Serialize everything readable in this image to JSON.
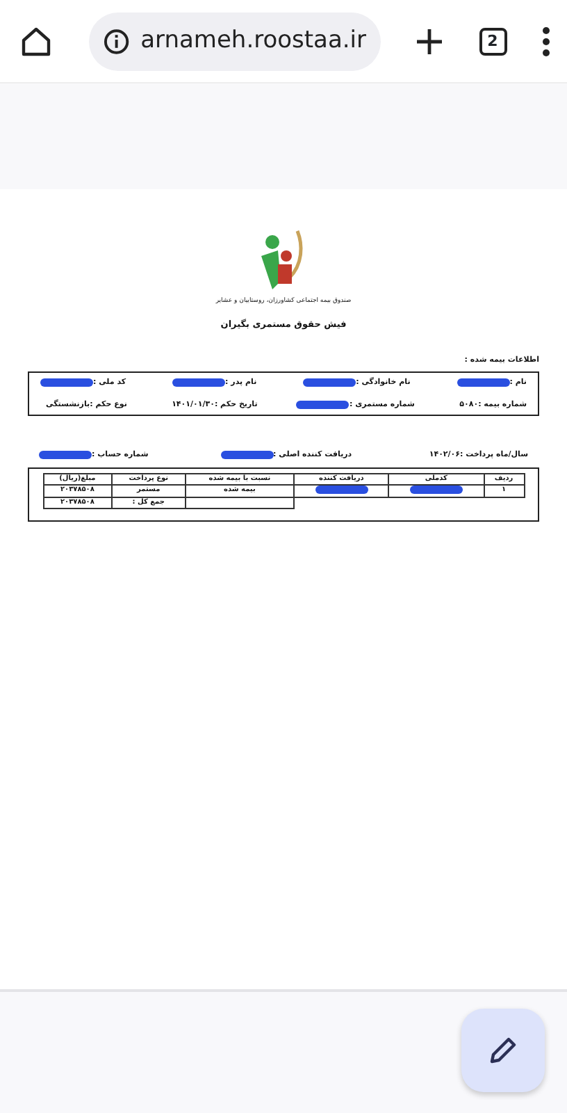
{
  "browser": {
    "url": "arnameh.roostaa.ir",
    "tab_count": "2"
  },
  "document": {
    "organization": "صندوق بیمه اجتماعی کشاورزان، روستاییان و عشایر",
    "title": "فیش حقوق مستمری بگیران",
    "section_label": "اطلاعات بیمه شده :",
    "info_rows": [
      [
        {
          "label": "نام :"
        },
        {
          "label": "نام خانوادگی :"
        },
        {
          "label": "نام پدر :"
        },
        {
          "label": "کد ملی :"
        }
      ],
      [
        {
          "label": "شماره بیمه :",
          "value": "۵۰۸۰"
        },
        {
          "label": "شماره مستمری :"
        },
        {
          "label": "تاریخ حکم :",
          "value": "۱۴۰۱/۰۱/۳۰"
        },
        {
          "label": "نوع حکم :",
          "value": "بازنشستگی"
        }
      ]
    ],
    "payment_line": [
      {
        "label": "سال/ماه پرداخت :",
        "value": "۱۴۰۲/۰۶"
      },
      {
        "label": "دریافت کننده اصلی :"
      },
      {
        "label": "شماره حساب :"
      }
    ],
    "table": {
      "columns": [
        "ردیف",
        "کدملی",
        "دریافت کننده",
        "نسبت با بیمه شده",
        "نوع پرداخت",
        "مبلغ(ریال)"
      ],
      "rows": [
        [
          "۱",
          null,
          null,
          "بیمه شده",
          "مستمر",
          "۲۰۳۷۸۵۰۸"
        ]
      ],
      "total_label": "جمع کل :",
      "total": "۲۰۳۷۸۵۰۸"
    }
  }
}
